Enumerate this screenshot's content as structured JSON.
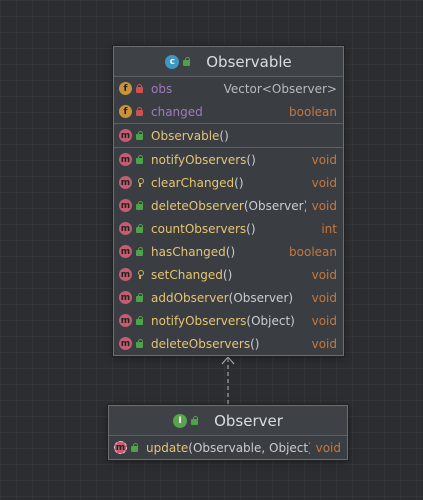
{
  "observable": {
    "title": "Observable",
    "kind_icon": "class-icon",
    "fields": [
      {
        "name": "obs",
        "type": "Vector<Observer>",
        "visibility": "private"
      },
      {
        "name": "changed",
        "type": "boolean",
        "visibility": "private"
      }
    ],
    "constructors": [
      {
        "name": "Observable",
        "params": "()",
        "visibility": "public"
      }
    ],
    "methods": [
      {
        "name": "notifyObservers",
        "params": "()",
        "type": "void",
        "visibility": "public"
      },
      {
        "name": "clearChanged",
        "params": "()",
        "type": "void",
        "visibility": "protected"
      },
      {
        "name": "deleteObserver",
        "params": "(Observer)",
        "type": "void",
        "visibility": "public"
      },
      {
        "name": "countObservers",
        "params": "()",
        "type": "int",
        "visibility": "public"
      },
      {
        "name": "hasChanged",
        "params": "()",
        "type": "boolean",
        "visibility": "public"
      },
      {
        "name": "setChanged",
        "params": "()",
        "type": "void",
        "visibility": "protected"
      },
      {
        "name": "addObserver",
        "params": "(Observer)",
        "type": "void",
        "visibility": "public"
      },
      {
        "name": "notifyObservers",
        "params": "(Object)",
        "type": "void",
        "visibility": "public"
      },
      {
        "name": "deleteObservers",
        "params": "()",
        "type": "void",
        "visibility": "public"
      }
    ]
  },
  "observer": {
    "title": "Observer",
    "kind_icon": "interface-icon",
    "methods": [
      {
        "name": "update",
        "params": "(Observable, Object)",
        "type": "void",
        "visibility": "public",
        "abstract": true
      }
    ]
  },
  "relation": {
    "type": "dependency",
    "style": "dashed-open-arrow"
  },
  "colors": {
    "background": "#2b2d30",
    "node_fill": "#3a3d42",
    "method_badge": "#c65c72",
    "field_badge": "#c9933a",
    "class_badge": "#3f98c2",
    "interface_badge": "#5aa24e",
    "method_name": "#e6c573",
    "field_name": "#a07bbd",
    "return_type": "#c7773e"
  }
}
